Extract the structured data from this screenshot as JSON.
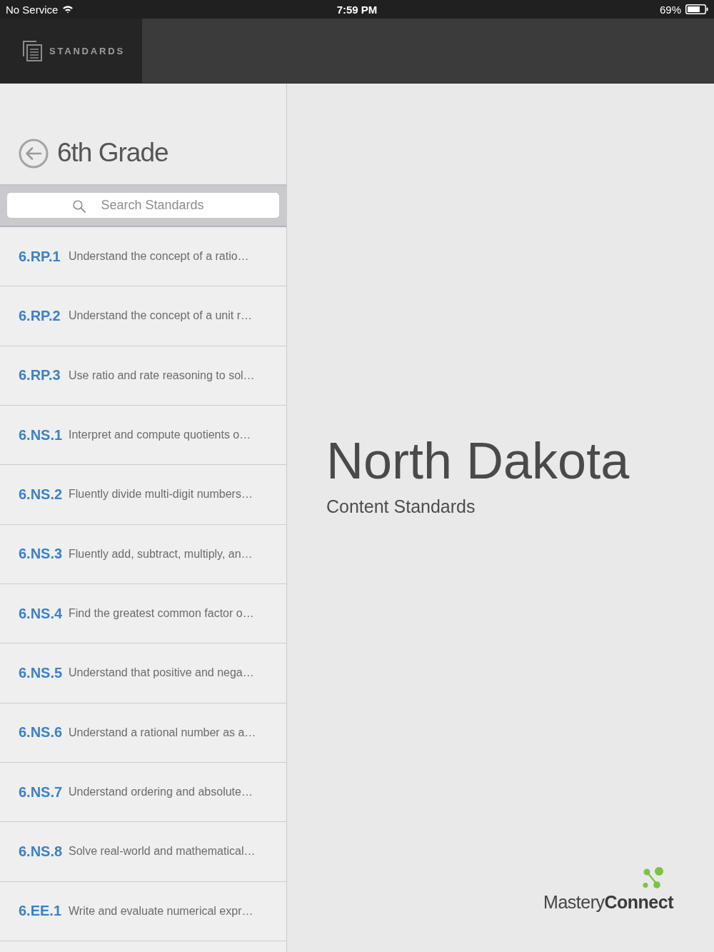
{
  "status_bar": {
    "carrier": "No Service",
    "time": "7:59 PM",
    "battery": "69%"
  },
  "nav": {
    "tabs": [
      {
        "label": "STANDARDS",
        "selected": true
      }
    ]
  },
  "sidebar": {
    "title": "6th Grade",
    "search": {
      "placeholder": "Search Standards"
    },
    "items": [
      {
        "code": "6.RP.1",
        "description": "Understand the concept of a ratio…"
      },
      {
        "code": "6.RP.2",
        "description": "Understand the concept of a unit r…"
      },
      {
        "code": "6.RP.3",
        "description": "Use ratio and rate reasoning to sol…"
      },
      {
        "code": "6.NS.1",
        "description": "Interpret and compute quotients o…"
      },
      {
        "code": "6.NS.2",
        "description": "Fluently divide multi-digit numbers…"
      },
      {
        "code": "6.NS.3",
        "description": "Fluently add, subtract, multiply, an…"
      },
      {
        "code": "6.NS.4",
        "description": "Find the greatest common factor o…"
      },
      {
        "code": "6.NS.5",
        "description": "Understand that positive and nega…"
      },
      {
        "code": "6.NS.6",
        "description": "Understand a rational number as a…"
      },
      {
        "code": "6.NS.7",
        "description": "Understand ordering and absolute…"
      },
      {
        "code": "6.NS.8",
        "description": "Solve real-world and mathematical…"
      },
      {
        "code": "6.EE.1",
        "description": "Write and evaluate numerical expr…"
      }
    ]
  },
  "main": {
    "title": "North Dakota",
    "subtitle": "Content Standards",
    "logo": "Mastery**Connect**"
  }
}
